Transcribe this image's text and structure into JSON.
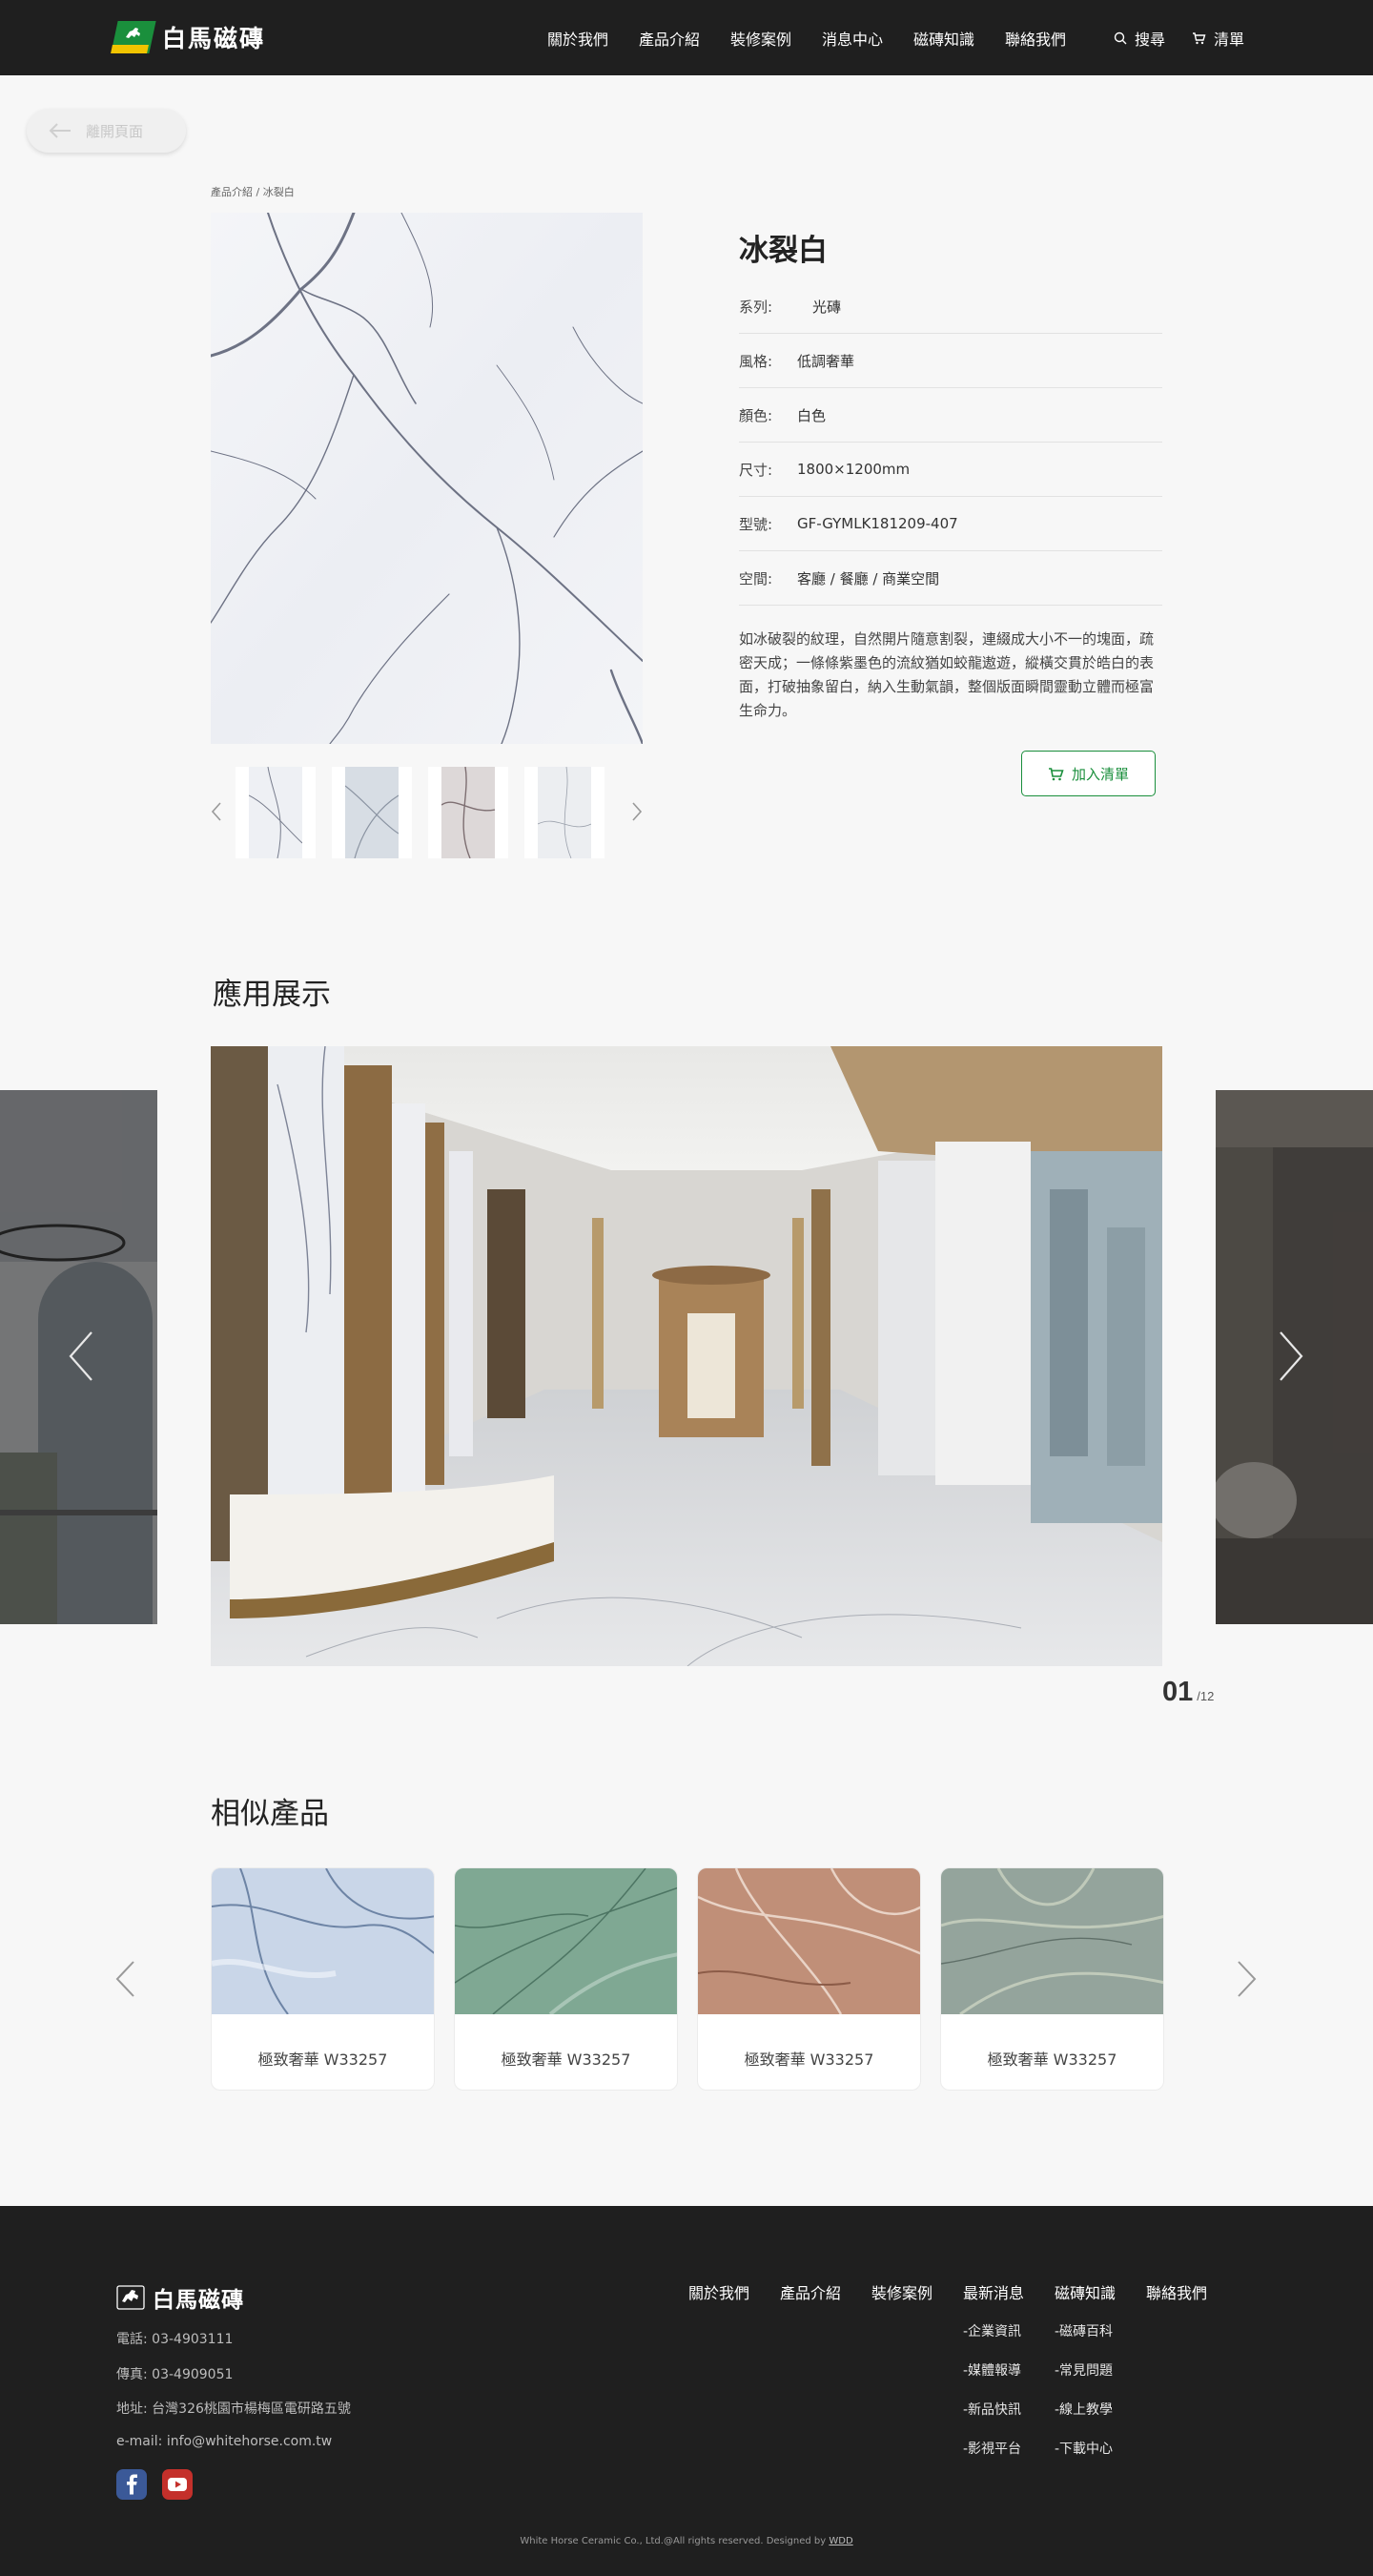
{
  "header": {
    "logo_text": "白馬磁磚",
    "nav": [
      "關於我們",
      "產品介紹",
      "裝修案例",
      "消息中心",
      "磁磚知識",
      "聯絡我們"
    ],
    "search_label": "搜尋",
    "cart_label": "清單"
  },
  "back_button": {
    "label": "離開頁面"
  },
  "breadcrumb": "產品介紹 / 冰裂白",
  "product": {
    "title": "冰裂白",
    "specs": [
      {
        "key": "系列:",
        "value": "光磚"
      },
      {
        "key": "風格:",
        "value": "低調奢華"
      },
      {
        "key": "顏色:",
        "value": "白色"
      },
      {
        "key": "尺寸:",
        "value": "1800×1200mm"
      },
      {
        "key": "型號:",
        "value": "GF-GYMLK181209-407"
      },
      {
        "key": "空間:",
        "value": "客廳 / 餐廳 / 商業空間"
      }
    ],
    "description": "如冰破裂的紋理，自然開片隨意割裂，連綴成大小不一的塊面，疏密天成；一條條紫墨色的流紋猶如蛟龍遨遊，縱橫交貫於皓白的表面，打破抽象留白，納入生動氣韻，整個版面瞬間靈動立體而極富生命力。",
    "add_button": "加入清單"
  },
  "application": {
    "title": "應用展示",
    "current": "01",
    "total": "/12"
  },
  "similar": {
    "title": "相似產品",
    "items": [
      {
        "name": "極致奢華 W33257",
        "color": "#c9d6e8"
      },
      {
        "name": "極致奢華 W33257",
        "color": "#7fa893"
      },
      {
        "name": "極致奢華 W33257",
        "color": "#c08f78"
      },
      {
        "name": "極致奢華 W33257",
        "color": "#94a49c"
      }
    ]
  },
  "footer": {
    "logo_text": "白馬磁磚",
    "phone": "電話:  03-4903111",
    "fax": "傳真:  03-4909051",
    "address": "地址:  台灣326桃園市楊梅區電研路五號",
    "email": "e-mail:  info@whitehorse.com.tw",
    "nav": [
      "關於我們",
      "產品介紹",
      "裝修案例",
      "最新消息",
      "磁磚知識",
      "聯絡我們"
    ],
    "news_links": [
      "-企業資訊",
      "-媒體報導",
      "-新品快訊",
      "-影視平台"
    ],
    "knowledge_links": [
      "-磁磚百科",
      "-常見問題",
      "-線上教學",
      "-下載中心"
    ],
    "copyright": "White Horse Ceramic Co., Ltd.@All rights reserved. Designed by",
    "designer": "WDD"
  },
  "colors": {
    "header_bg": "#1f1f1f",
    "brand_green": "#1a8f3c",
    "brand_yellow": "#f1c400",
    "page_bg": "#f7f7f7"
  }
}
